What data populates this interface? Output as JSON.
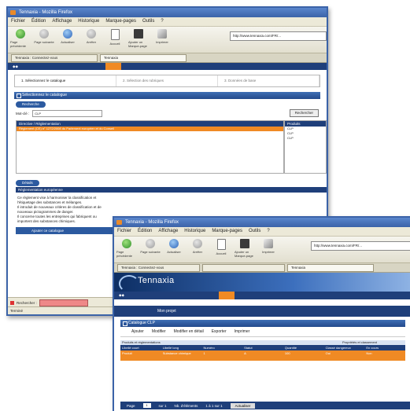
{
  "win1": {
    "title": "Tennaxia - Mozilla Firefox",
    "menu": [
      "Fichier",
      "Édition",
      "Affichage",
      "Historique",
      "Marque-pages",
      "Outils",
      "?"
    ],
    "toolbar": [
      "Page précédente",
      "Page suivante",
      "Actualiser",
      "Arrêter",
      "Accueil",
      "Ajouter un Marque-page",
      "Imprimer"
    ],
    "address": "http://www.tennaxia.com/FR/...",
    "tabs": [
      "Tennaxia : Connectez-vous",
      "Tennaxia"
    ],
    "wizard_steps": [
      "1. Sélectionnez le catalogue",
      "2. Sélection des rubriques",
      "3. Données de base"
    ],
    "section_title": "Sélectionnez le catalogue",
    "pill_search": "Recherche",
    "search_label": "Mot-clé :",
    "search_value": "CLP",
    "search_button": "Rechercher",
    "grid_header": "Directive / Réglementation",
    "grid_header_right": "Produits",
    "grid_selected_row": "Règlement (CE) n° 1272/2008 du Parlement européen et du Conseil",
    "grid_right_rows": [
      "CLP",
      "CLP",
      "CLP"
    ],
    "pill_details": "Détails",
    "details_header": "Réglementation européenne",
    "details_lines": [
      "Ce règlement vise à harmoniser la classification et l'étiquetage des substances et mélanges.",
      "Il introduit de nouveaux critères de classification et de nouveaux pictogrammes de danger.",
      "Il concerne toutes les entreprises qui fabriquent ou importent des substances chimiques."
    ],
    "details_button": "Ajouter ce catalogue",
    "find_label": "Rechercher :",
    "status": "Terminé"
  },
  "win2": {
    "title": "Tennaxia - Mozilla Firefox",
    "menu": [
      "Fichier",
      "Édition",
      "Affichage",
      "Historique",
      "Marque-pages",
      "Outils",
      "?"
    ],
    "toolbar": [
      "Page précédente",
      "Page suivante",
      "Actualiser",
      "Arrêter",
      "Accueil",
      "Ajouter un Marque-page",
      "Imprimer"
    ],
    "address": "http://www.tennaxia.com/FR/...",
    "tabs": [
      "Tennaxia : Connectez-vous",
      "Tennaxia"
    ],
    "logo_text": "Tennaxia",
    "header_title": "Mon projet",
    "section_title": "Catalogue CLP",
    "actions": [
      "Ajouter",
      "Modifier",
      "Modifier en détail",
      "Exporter",
      "Imprimer"
    ],
    "table_caption_left": "Produits et réglementations",
    "table_caption_right": "Propriétés et classement",
    "columns": [
      "Libellé court",
      "Libellé long",
      "Numéro",
      "Statut",
      "Quantité",
      "Classé dangereux",
      "En cours"
    ],
    "row": [
      "Produit",
      "Substance chimique",
      "1",
      "A",
      "100",
      "Oui",
      "Non"
    ],
    "pager_page_label": "Page",
    "pager_page": "1",
    "pager_of": "sur 1",
    "pager_per_page": "Nb. d'éléments",
    "pager_count": "1 à 1 sur 1",
    "pager_button": "Actualiser"
  },
  "colors": {
    "accent": "#f08a24",
    "navy": "#1f3f7a",
    "frame": "#3b63a8"
  }
}
